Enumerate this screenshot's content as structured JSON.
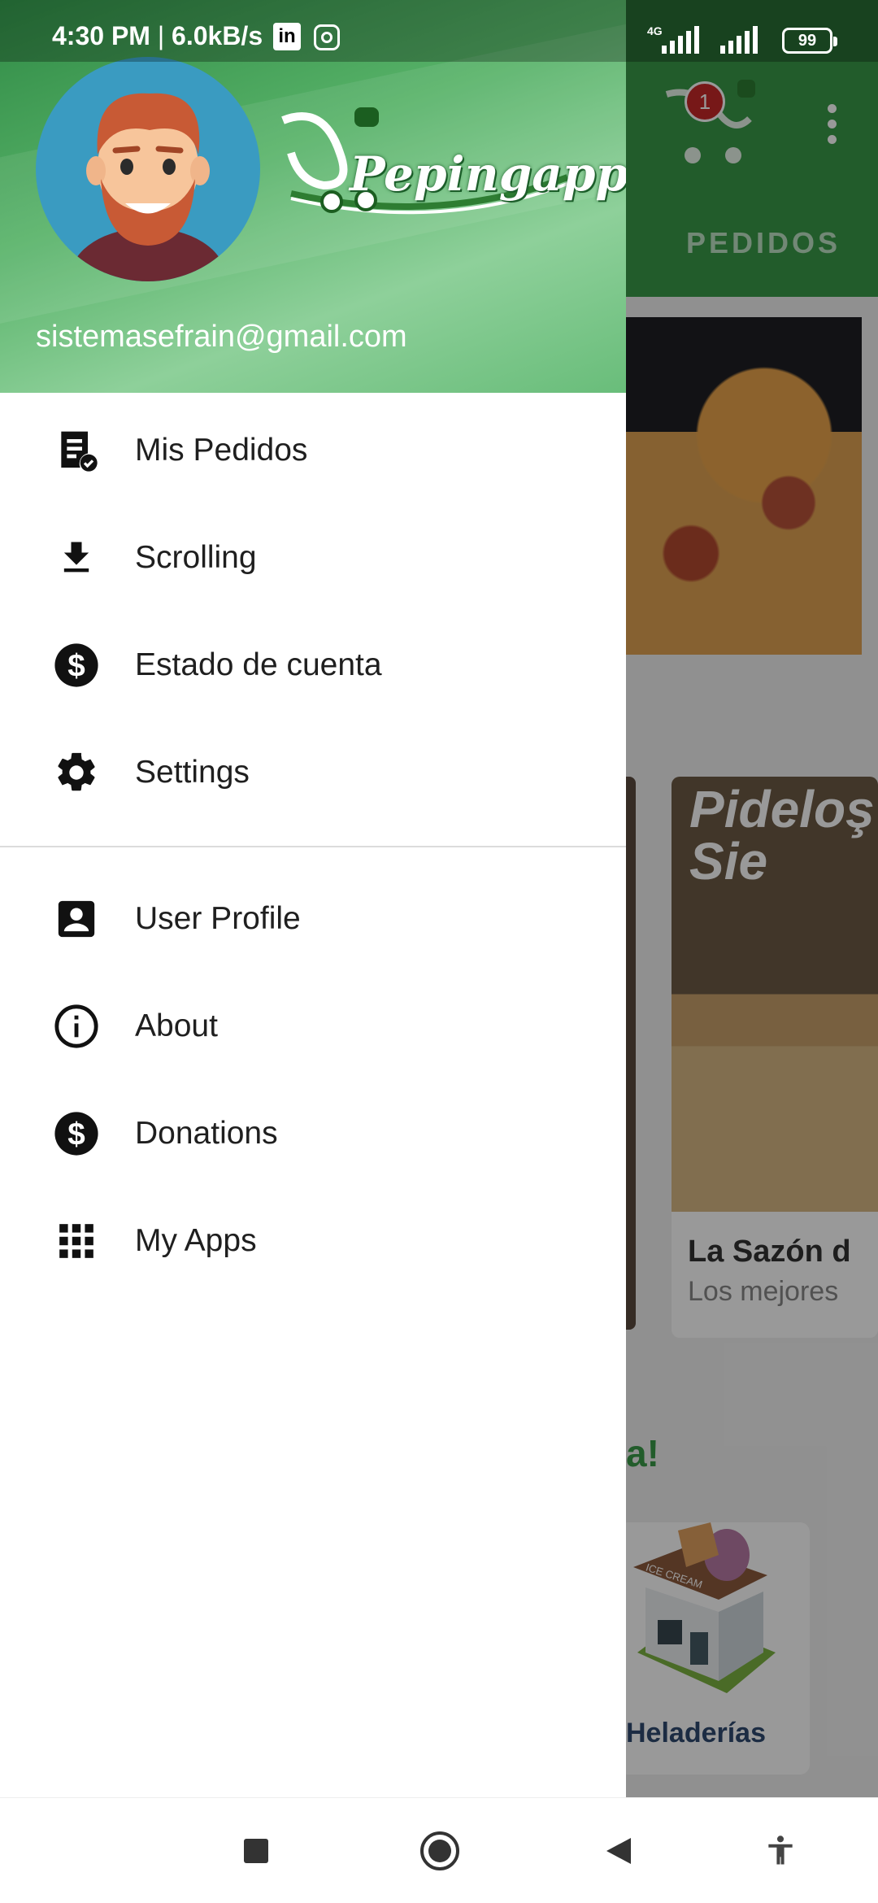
{
  "status_bar": {
    "time": "4:30 PM",
    "speed": "6.0kB/s",
    "network": "4G",
    "battery": "99"
  },
  "background_app": {
    "notification_count": "1",
    "tab_label": "PEDIDOS",
    "card_image_text": "Pideloş\nSie",
    "card_title": "La Sazón d",
    "card_subtitle": "Los mejores",
    "promo_fragment": "a!",
    "shop_image_text": "ICE CREAM",
    "category_label": "Heladerías"
  },
  "drawer": {
    "brand_name": "Pepingapp",
    "user_email": "sistemasefrain@gmail.com",
    "main_items": [
      {
        "label": "Mis Pedidos",
        "icon": "receipt-check-icon"
      },
      {
        "label": "Scrolling",
        "icon": "download-icon"
      },
      {
        "label": "Estado de cuenta",
        "icon": "dollar-circle-icon"
      },
      {
        "label": "Settings",
        "icon": "gear-icon"
      }
    ],
    "secondary_items": [
      {
        "label": "User Profile",
        "icon": "account-box-icon"
      },
      {
        "label": "About",
        "icon": "info-icon"
      },
      {
        "label": "Donations",
        "icon": "dollar-circle-icon"
      },
      {
        "label": "My Apps",
        "icon": "apps-grid-icon"
      }
    ]
  },
  "nav_bar": {
    "buttons": [
      "recents-button",
      "home-button",
      "back-button",
      "accessibility-button"
    ]
  },
  "colors": {
    "brand_green": "#3a9a49",
    "header_green": "#57b268",
    "avatar_bg": "#3a9bc1"
  }
}
